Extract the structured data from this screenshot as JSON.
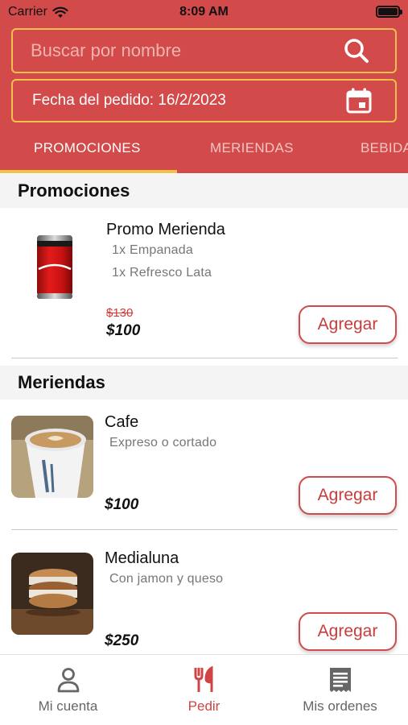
{
  "status_bar": {
    "carrier": "Carrier",
    "time": "8:09 AM"
  },
  "search": {
    "placeholder": "Buscar por nombre",
    "icon": "search-icon"
  },
  "order_date": {
    "label": "Fecha del pedido: 16/2/2023",
    "icon": "calendar-icon"
  },
  "tabs": [
    {
      "label": "PROMOCIONES",
      "active": true
    },
    {
      "label": "MERIENDAS",
      "active": false
    },
    {
      "label": "BEBIDA",
      "active": false
    }
  ],
  "sections": [
    {
      "title": "Promociones",
      "items": [
        {
          "name": "Promo Merienda",
          "details": [
            "1x Empanada",
            "1x Refresco Lata"
          ],
          "old_price": "$130",
          "price": "$100",
          "button": "Agregar"
        }
      ]
    },
    {
      "title": "Meriendas",
      "items": [
        {
          "name": "Cafe",
          "details": [
            "Expreso o cortado"
          ],
          "price": "$100",
          "button": "Agregar"
        },
        {
          "name": "Medialuna",
          "details": [
            "Con jamon y queso"
          ],
          "price": "$250",
          "button": "Agregar"
        }
      ]
    }
  ],
  "bottom_nav": [
    {
      "label": "Mi cuenta",
      "icon": "user-icon",
      "active": false
    },
    {
      "label": "Pedir",
      "icon": "utensils-icon",
      "active": true
    },
    {
      "label": "Mis ordenes",
      "icon": "receipt-icon",
      "active": false
    }
  ],
  "colors": {
    "primary": "#d24a4a",
    "accent": "#f1c24b",
    "active_nav": "#d04444"
  }
}
